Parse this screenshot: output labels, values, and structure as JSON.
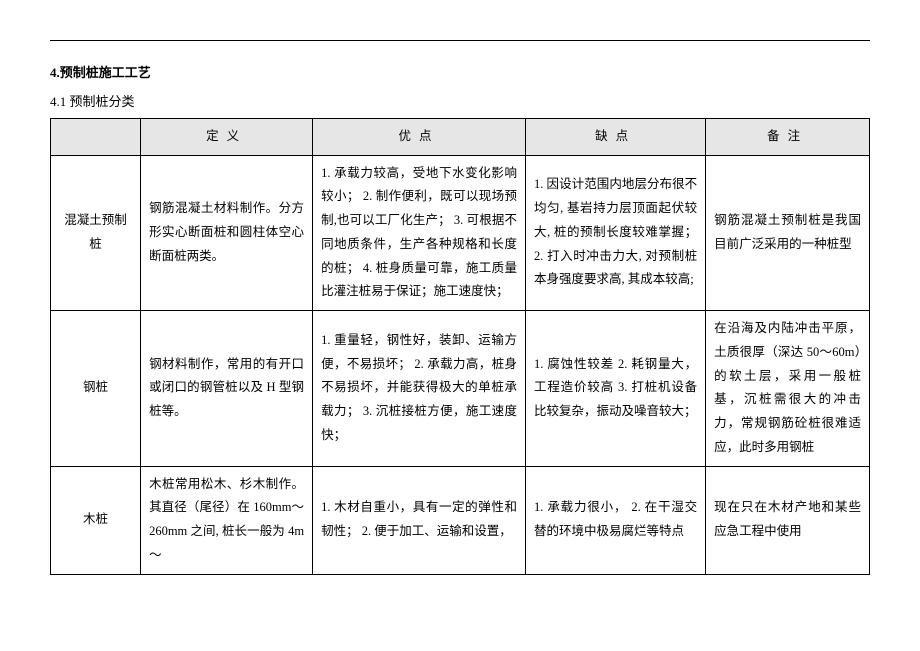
{
  "section_title": "4.预制桩施工工艺",
  "subsection": "4.1 预制桩分类",
  "headers": {
    "name": "",
    "def": "定义",
    "pros": "优点",
    "cons": "缺点",
    "notes": "备注"
  },
  "rows": [
    {
      "name": "混凝土预制桩",
      "def": "钢筋混凝土材料制作。分方形实心断面桩和圆柱体空心断面桩两类。",
      "pros": "1. 承载力较高，受地下水变化影响较小；\n2. 制作便利，既可以现场预制,也可以工厂化生产；\n3. 可根据不同地质条件，生产各种规格和长度的桩；\n4. 桩身质量可靠，施工质量比灌注桩易于保证；施工速度快；",
      "cons": "1. 因设计范围内地层分布很不均匀, 基岩持力层顶面起伏较大, 桩的预制长度较难掌握；\n2. 打入时冲击力大, 对预制桩本身强度要求高, 其成本较高;",
      "notes": "钢筋混凝土预制桩是我国目前广泛采用的一种桩型"
    },
    {
      "name": "钢桩",
      "def": "钢材料制作，常用的有开口或闭口的钢管桩以及 H 型钢桩等。",
      "pros": "1. 重量轻，钢性好，装卸、运输方便，不易损坏；\n2. 承载力高，桩身不易损坏，并能获得极大的单桩承载力；\n3. 沉桩接桩方便，施工速度快；",
      "cons": "1. 腐蚀性较差\n2. 耗钢量大，工程造价较高\n3. 打桩机设备比较复杂，振动及噪音较大；",
      "notes": "在沿海及内陆冲击平原，土质很厚（深达 50～60m）的软土层，采用一般桩基，沉桩需很大的冲击力，常规钢筋砼桩很难适应，此时多用钢桩"
    },
    {
      "name": "木桩",
      "def": "木桩常用松木、杉木制作。其直径（尾径）在 160mm～260mm 之间, 桩长一般为 4m～",
      "pros": "1. 木材自重小，具有一定的弹性和韧性；\n2. 便于加工、运输和设置，",
      "cons": "1. 承载力很小，\n2. 在干湿交替的环境中极易腐烂等特点",
      "notes": "现在只在木材产地和某些应急工程中使用"
    }
  ]
}
